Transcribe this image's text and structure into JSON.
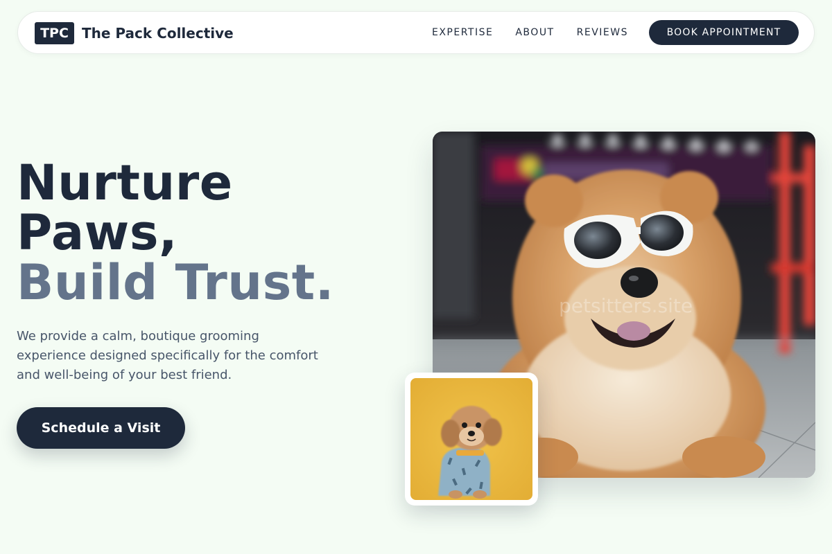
{
  "brand": {
    "badge": "TPC",
    "name": "The Pack Collective"
  },
  "nav": {
    "links": [
      "EXPERTISE",
      "ABOUT",
      "REVIEWS"
    ],
    "cta": "BOOK APPOINTMENT"
  },
  "hero": {
    "title_line1": "Nurture",
    "title_line2": "Paws,",
    "title_accent": "Build Trust.",
    "description": "We provide a calm, boutique grooming experience designed specifically for the comfort and well-being of your best friend.",
    "cta": "Schedule a Visit"
  },
  "images": {
    "main_alt": "Fluffy chow chow dog wearing white sunglasses",
    "watermark": "petsitters.site",
    "small_alt": "Small shih tzu puppy in a blue patterned outfit on a yellow background"
  },
  "colors": {
    "background": "#f4fcf4",
    "primary": "#1e293b",
    "accent_text": "#64748b",
    "body_text": "#475569",
    "small_photo_bg": "#e9b73c"
  }
}
